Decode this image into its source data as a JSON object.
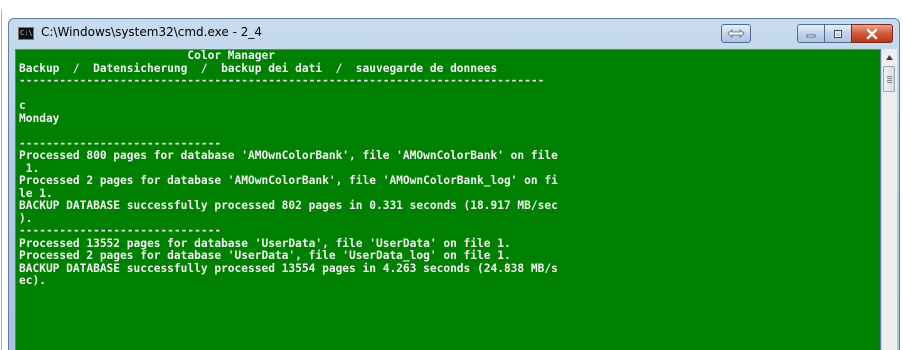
{
  "window": {
    "title": "C:\\Windows\\system32\\cmd.exe - 2_4",
    "app_icon_text": "C:\\"
  },
  "console": {
    "lines": [
      "                         Color Manager",
      "Backup  /  Datensicherung  /  backup dei dati  /  sauvegarde de donnees",
      "------------------------------------------------------------------------------",
      "",
      "c",
      "Monday",
      "",
      "------------------------------",
      "Processed 800 pages for database 'AMOwnColorBank', file 'AMOwnColorBank' on file",
      " 1.",
      "Processed 2 pages for database 'AMOwnColorBank', file 'AMOwnColorBank_log' on fi",
      "le 1.",
      "BACKUP DATABASE successfully processed 802 pages in 0.331 seconds (18.917 MB/sec",
      ").",
      "------------------------------",
      "Processed 13552 pages for database 'UserData', file 'UserData' on file 1.",
      "Processed 2 pages for database 'UserData', file 'UserData_log' on file 1.",
      "BACKUP DATABASE successfully processed 13554 pages in 4.263 seconds (24.838 MB/s",
      "ec)."
    ]
  },
  "colors": {
    "console_background": "#008000",
    "console_text": "#f2f2f2",
    "close_button": "#c8482b"
  },
  "icons": {
    "app": "cmd-icon",
    "switch": "switch-icon",
    "minimize": "minimize-icon",
    "maximize": "maximize-icon",
    "close": "close-icon",
    "scroll_up": "arrow-up-icon"
  }
}
